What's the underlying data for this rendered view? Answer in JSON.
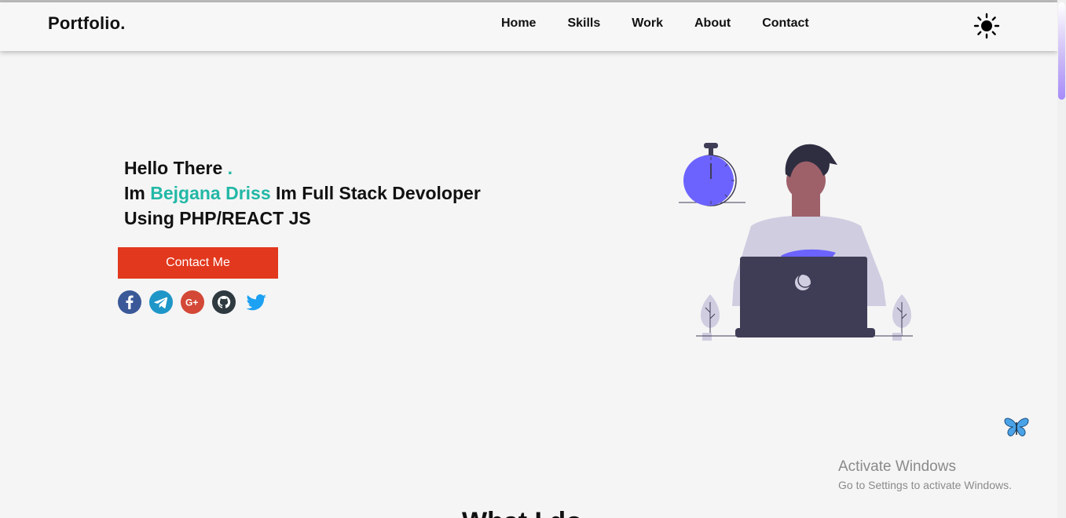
{
  "header": {
    "brand": "Portfolio.",
    "nav": [
      "Home",
      "Skills",
      "Work",
      "About",
      "Contact"
    ],
    "theme_icon": "sun-icon"
  },
  "hero": {
    "greeting": "Hello There",
    "greeting_dot": ".",
    "intro_prefix": "Im",
    "name": "Bejgana Driss",
    "intro_suffix": "Im Full Stack Devoloper",
    "line3": "Using PHP/REACT JS",
    "cta_label": "Contact Me",
    "socials": [
      {
        "name": "facebook-icon",
        "color": "#3b5998"
      },
      {
        "name": "telegram-icon",
        "color": "#1e96c8"
      },
      {
        "name": "google-plus-icon",
        "color": "#d34836"
      },
      {
        "name": "github-icon",
        "color": "#2f3a40"
      },
      {
        "name": "twitter-icon",
        "color": "#1da1f2"
      }
    ]
  },
  "colors": {
    "accent": "#22b8a6",
    "cta": "#e2381d",
    "illustration_purple": "#6c63ff",
    "laptop": "#3f3d56"
  },
  "overlay": {
    "activate_title": "Activate Windows",
    "activate_sub": "Go to Settings to activate Windows."
  },
  "next_section": {
    "title_peek": "What I do"
  }
}
